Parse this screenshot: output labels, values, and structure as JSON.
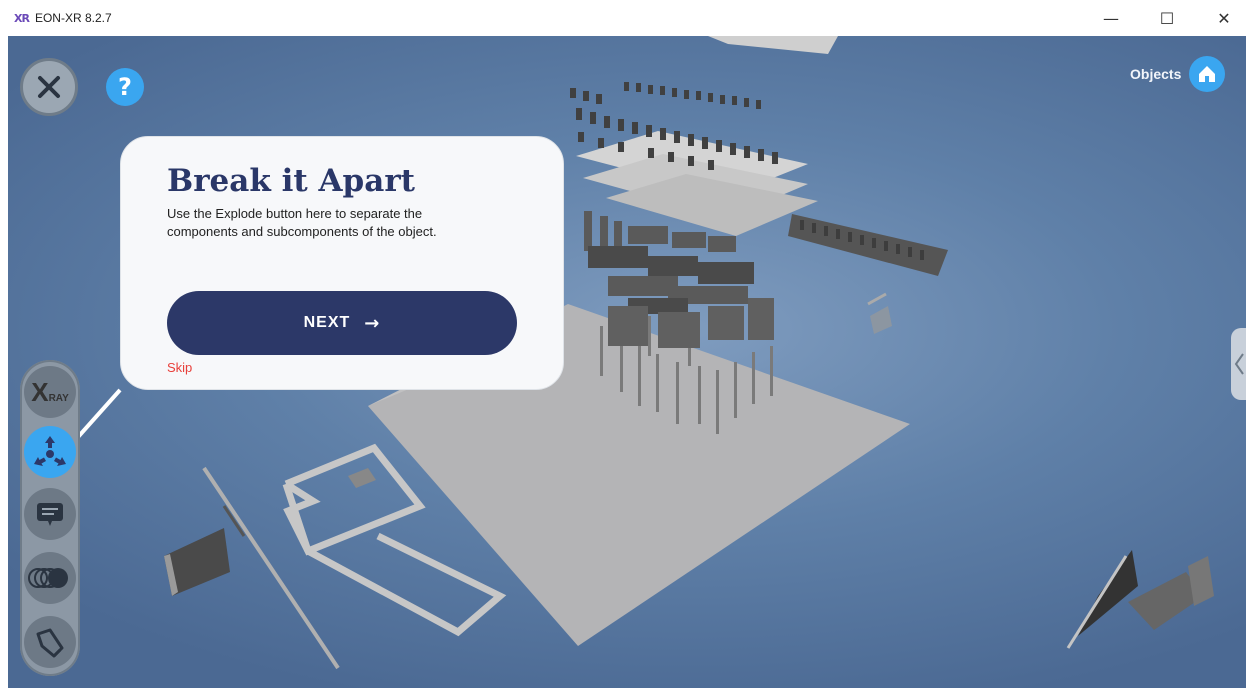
{
  "window": {
    "logo": "XR",
    "title": "EON-XR 8.2.7",
    "minimize_glyph": "—",
    "maximize_glyph": "☐",
    "close_glyph": "✕"
  },
  "overlay": {
    "help_glyph": "?",
    "objects_label": "Objects"
  },
  "toolbar": {
    "xray_big": "X",
    "xray_small": "RAY",
    "tools": [
      "xray-icon",
      "explode-icon",
      "annotation-icon",
      "layers-icon",
      "slice-icon"
    ],
    "active_tool": "explode-icon"
  },
  "popover": {
    "title": "Break it Apart",
    "body": "Use the Explode button here to separate the components  and subcomponents of the object.",
    "next_label": "NEXT",
    "next_arrow": "→",
    "skip_label": "Skip"
  },
  "colors": {
    "accent": "#3aa6f0",
    "primary": "#2c3868",
    "skip": "#e8403b",
    "viewport": "#5f80a8"
  }
}
